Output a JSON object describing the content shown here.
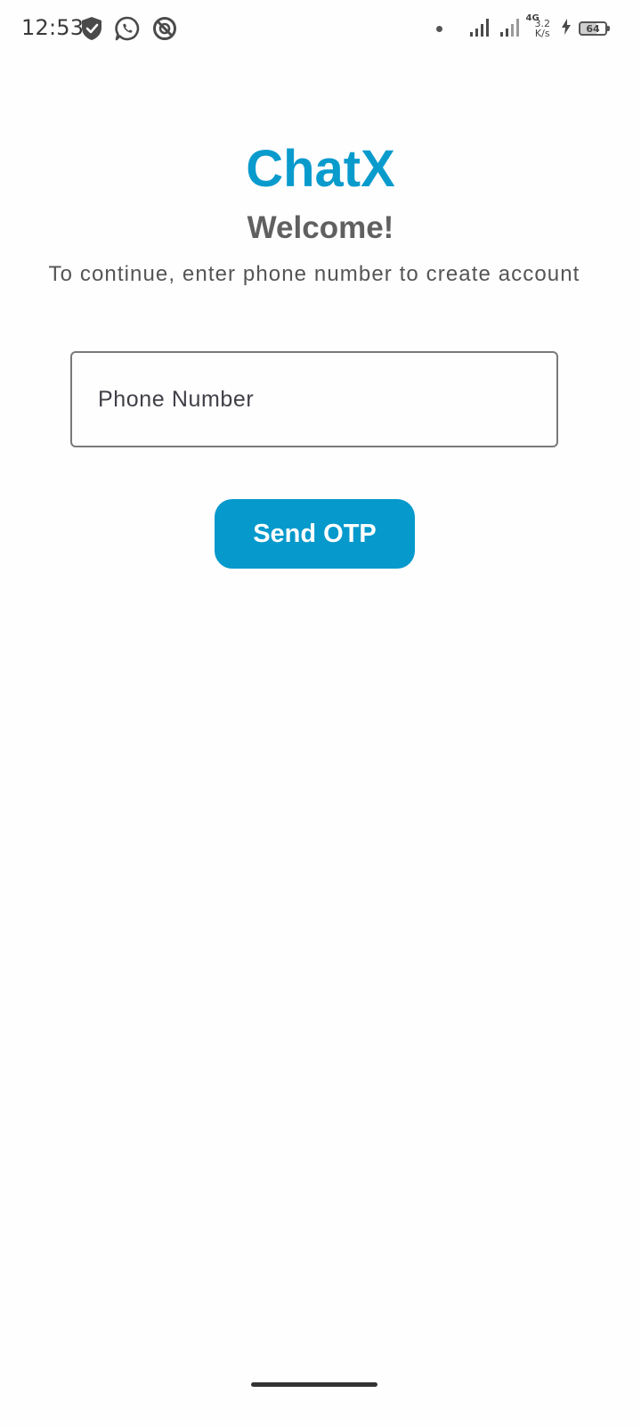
{
  "status_bar": {
    "time": "12:53",
    "left_icons": [
      "shield-icon",
      "whatsapp-icon",
      "location-off-icon"
    ],
    "network_type": "4G",
    "speed_value": "3.2",
    "speed_unit": "K/s",
    "battery_level": "64",
    "battery_fraction": 0.64,
    "charging": true
  },
  "app": {
    "title": "ChatX",
    "welcome": "Welcome!",
    "subtitle": "To continue, enter phone number to create account"
  },
  "form": {
    "phone_value": "",
    "phone_placeholder": "Phone Number",
    "send_button_label": "Send OTP"
  },
  "colors": {
    "accent": "#0599cc",
    "title": "#0a9bcd",
    "text_gray": "#606060",
    "background": "#fefefe"
  }
}
